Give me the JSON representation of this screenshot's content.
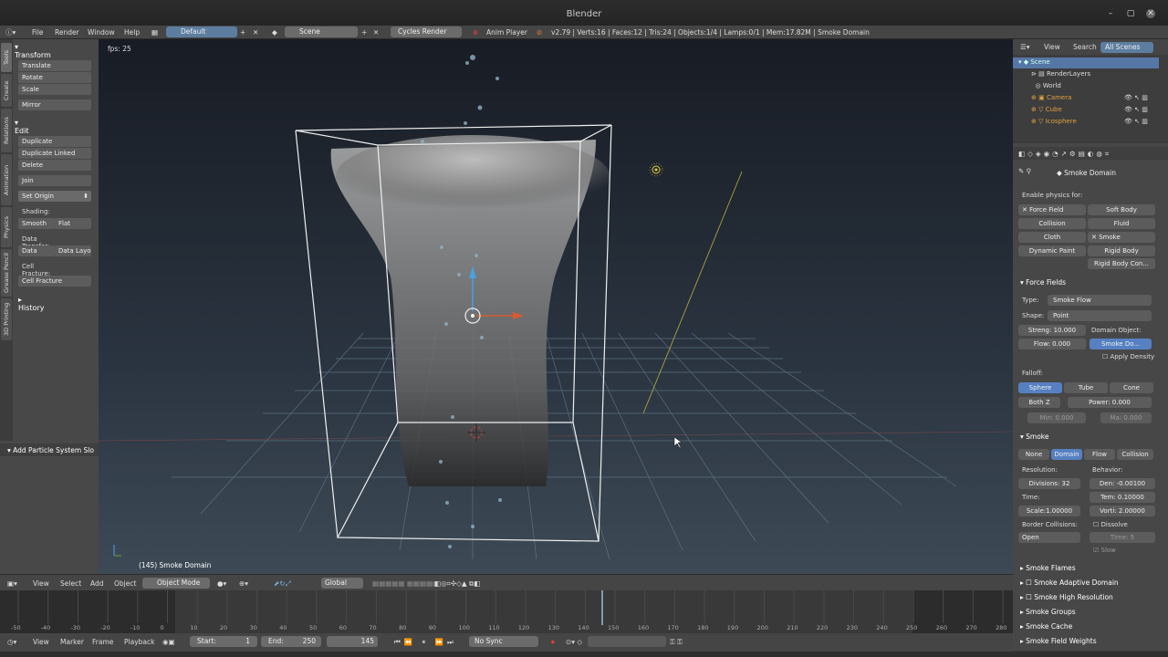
{
  "window": {
    "title": "Blender"
  },
  "menu": {
    "items": [
      "File",
      "Render",
      "Window",
      "Help"
    ],
    "screen_layout": "Default",
    "scene": "Scene",
    "engine": "Cycles Render",
    "anim_player": "Anim Player",
    "stats": "v2.79 | Verts:16 | Faces:12 | Tris:24 | Objects:1/4 | Lamps:0/1 | Mem:17.82M | Smoke Domain"
  },
  "toolshelf": {
    "tabs": [
      "Tools",
      "Create",
      "Relations",
      "Animation",
      "Physics",
      "Grease Pencil",
      "3D Printing"
    ],
    "transform_header": "Transform",
    "transform_buttons": [
      "Translate",
      "Rotate",
      "Scale"
    ],
    "mirror": "Mirror",
    "edit_header": "Edit",
    "edit_buttons": [
      "Duplicate",
      "Duplicate Linked",
      "Delete"
    ],
    "join": "Join",
    "set_origin": "Set Origin",
    "shading_label": "Shading:",
    "smooth": "Smooth",
    "flat": "Flat",
    "data_transfer_label": "Data Transfer:",
    "data": "Data",
    "data_layout": "Data Layo",
    "cell_fracture_label": "Cell Fracture:",
    "cell_fracture": "Cell Fracture",
    "history": "History",
    "operator_panel": "Add Particle System Slo"
  },
  "viewport": {
    "fps": "fps: 25",
    "object_info": "(145) Smoke Domain"
  },
  "outliner": {
    "menu": [
      "View",
      "Search"
    ],
    "scope": "All Scenes",
    "items": [
      "Scene",
      "RenderLayers",
      "World",
      "Camera",
      "Cube",
      "Icosphere"
    ]
  },
  "properties": {
    "context_object": "Smoke Domain",
    "enable_physics_label": "Enable physics for:",
    "physics_buttons": [
      "Force Field",
      "Soft Body",
      "Collision",
      "Fluid",
      "Cloth",
      "Smoke",
      "Dynamic Paint",
      "Rigid Body",
      "Rigid Body Con..."
    ],
    "force_fields": {
      "header": "Force Fields",
      "type_label": "Type:",
      "type_value": "Smoke Flow",
      "shape_label": "Shape:",
      "shape_value": "Point",
      "strength": "Streng: 10.000",
      "flow": "Flow:",
      "flow_value": "0.000",
      "domain_object_label": "Domain Object:",
      "domain_object": "Smoke Do...",
      "apply_density": "Apply Density",
      "falloff_label": "Falloff:",
      "falloff_options": [
        "Sphere",
        "Tube",
        "Cone"
      ],
      "both_z": "Both Z",
      "power": "Power:",
      "power_value": "0.000",
      "min": "Min: 0.000",
      "max": "Ma: 0.000"
    },
    "smoke": {
      "header": "Smoke",
      "tabs": [
        "None",
        "Domain",
        "Flow",
        "Collision"
      ],
      "resolution_label": "Resolution:",
      "behavior_label": "Behavior:",
      "divisions": "Divisions:",
      "divisions_value": "32",
      "density": "Den: -0.00100",
      "time_label": "Time:",
      "temp": "Tem: 0.10000",
      "scale": "Scale:1.00000",
      "vorticity": "Vorti: 2.00000",
      "border_collisions_label": "Border Collisions:",
      "dissolve": "Dissolve",
      "border_value": "Open",
      "time_value": "Time:",
      "time_number": "5",
      "slow": "Slow"
    },
    "subpanels": [
      "Smoke Flames",
      "Smoke Adaptive Domain",
      "Smoke High Resolution",
      "Smoke Groups",
      "Smoke Cache",
      "Smoke Field Weights"
    ]
  },
  "viewport_header": {
    "menu": [
      "View",
      "Select",
      "Add",
      "Object"
    ],
    "mode": "Object Mode",
    "orientation": "Global"
  },
  "timeline": {
    "ticks": [
      "-50",
      "-40",
      "-30",
      "-20",
      "-10",
      "0",
      "10",
      "20",
      "30",
      "40",
      "50",
      "60",
      "70",
      "80",
      "90",
      "100",
      "110",
      "120",
      "130",
      "140",
      "150",
      "160",
      "170",
      "180",
      "190",
      "200",
      "210",
      "220",
      "230",
      "240",
      "250",
      "260",
      "270",
      "280"
    ],
    "menu": [
      "View",
      "Marker",
      "Frame",
      "Playback"
    ],
    "start_label": "Start:",
    "start": "1",
    "end_label": "End:",
    "end": "250",
    "current": "145",
    "sync": "No Sync"
  }
}
